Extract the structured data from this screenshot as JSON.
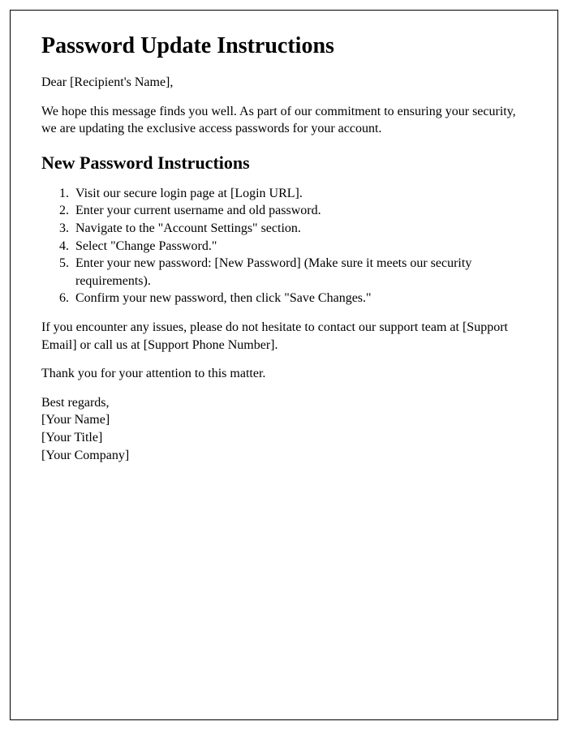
{
  "title": "Password Update Instructions",
  "greeting": "Dear [Recipient's Name],",
  "intro": "We hope this message finds you well. As part of our commitment to ensuring your security, we are updating the exclusive access passwords for your account.",
  "section_heading": "New Password Instructions",
  "steps": [
    "Visit our secure login page at [Login URL].",
    "Enter your current username and old password.",
    "Navigate to the \"Account Settings\" section.",
    "Select \"Change Password.\"",
    "Enter your new password: [New Password] (Make sure it meets our security requirements).",
    "Confirm your new password, then click \"Save Changes.\""
  ],
  "support": "If you encounter any issues, please do not hesitate to contact our support team at [Support Email] or call us at [Support Phone Number].",
  "thanks": "Thank you for your attention to this matter.",
  "signoff": {
    "regards": "Best regards,",
    "name": "[Your Name]",
    "title": "[Your Title]",
    "company": "[Your Company]"
  }
}
